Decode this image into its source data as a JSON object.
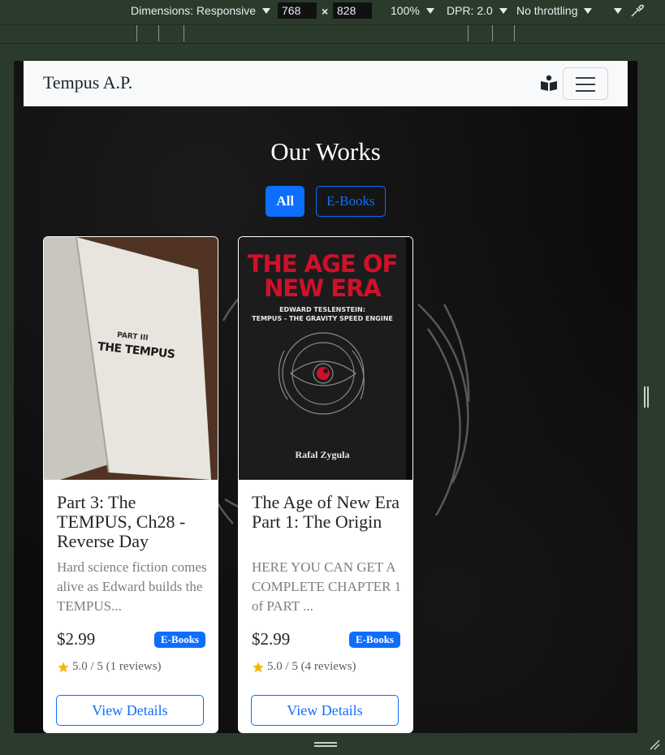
{
  "devtools": {
    "dimensions_label": "Dimensions: Responsive",
    "width": "768",
    "times": "×",
    "height": "828",
    "zoom": "100%",
    "dpr": "DPR: 2.0",
    "throttling": "No throttling"
  },
  "navbar": {
    "brand": "Tempus A.P.",
    "icon": "book-reader-icon",
    "toggler_icon": "hamburger-icon"
  },
  "page": {
    "title": "Our Works",
    "filters": [
      {
        "label": "All",
        "active": true
      },
      {
        "label": "E-Books",
        "active": false
      }
    ]
  },
  "cards": [
    {
      "title": "Part 3: The TEMPUS, Ch28 - Reverse Day",
      "description": "Hard science fiction comes alive as Edward builds the TEMPUS...",
      "price": "$2.99",
      "badge": "E-Books",
      "rating": "5.0 / 5 (1 reviews)",
      "button": "View Details",
      "cover": {
        "part": "PART III",
        "name": "THE TEMPUS"
      }
    },
    {
      "title": "The Age of New Era Part 1: The Origin",
      "description": "HERE YOU CAN GET A COMPLETE CHAPTER 1 of PART ...",
      "price": "$2.99",
      "badge": "E-Books",
      "rating": "5.0 / 5 (4 reviews)",
      "button": "View Details",
      "cover": {
        "title_line1": "THE AGE OF",
        "title_line2": "NEW ERA",
        "subtitle1": "EDWARD TESLENSTEIN:",
        "subtitle2": "TEMPUS - THE GRAVITY SPEED ENGINE",
        "author": "Rafal Zygula"
      }
    }
  ],
  "colors": {
    "primary": "#0d6efd",
    "navbar_bg": "#f8f9fa",
    "page_bg": "#0c0c0c",
    "cover_red": "#d0102a",
    "star": "#f5b50a"
  }
}
